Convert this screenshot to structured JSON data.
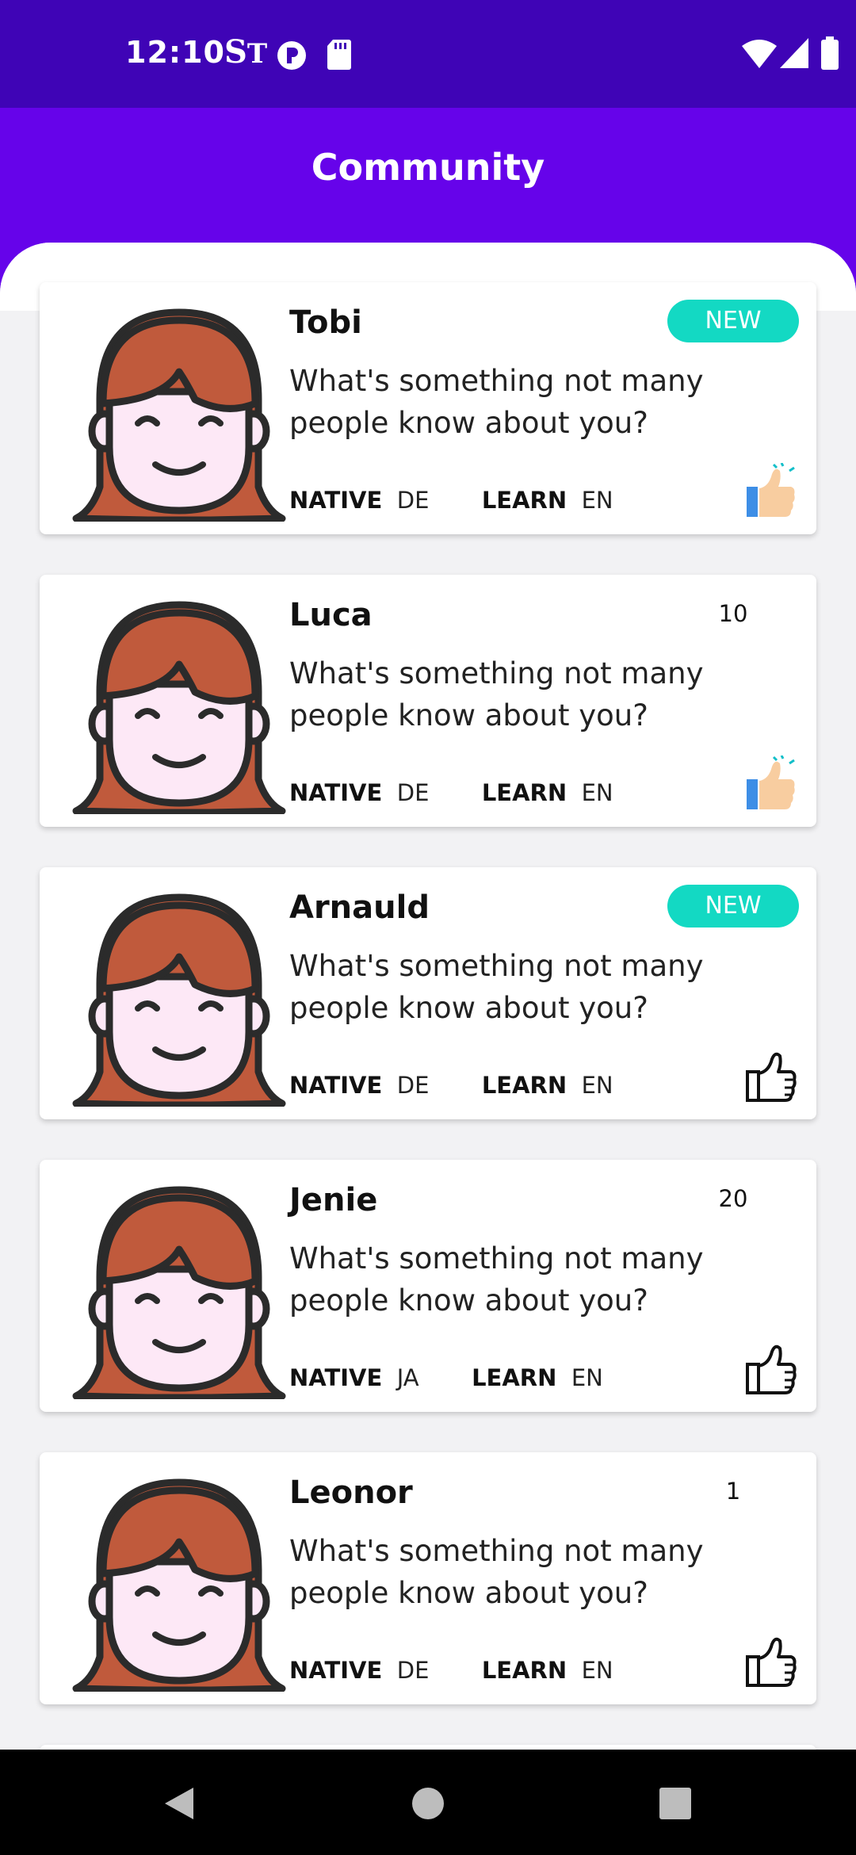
{
  "status_bar": {
    "time": "12:10",
    "left_icons": [
      "st-app-icon",
      "p-app-icon",
      "sd-card-icon"
    ],
    "right_icons": [
      "wifi-icon",
      "cell-signal-icon",
      "battery-icon"
    ]
  },
  "app_bar": {
    "title": "Community"
  },
  "colors": {
    "status_bar": "#3f04b6",
    "app_bar": "#6603ea",
    "new_badge": "#13d9c3",
    "hair": "#c05a3c",
    "face": "#fde8f6"
  },
  "cards": [
    {
      "name": "Tobi",
      "question": "What's something not many people know about you?",
      "native_label": "NATIVE",
      "native": "DE",
      "learn_label": "LEARN",
      "learn": "EN",
      "badge": "NEW",
      "count": "",
      "liked": true
    },
    {
      "name": "Luca",
      "question": "What's something not many people know about you?",
      "native_label": "NATIVE",
      "native": "DE",
      "learn_label": "LEARN",
      "learn": "EN",
      "badge": "",
      "count": "10",
      "liked": true
    },
    {
      "name": "Arnauld",
      "question": "What's something not many people know about you?",
      "native_label": "NATIVE",
      "native": "DE",
      "learn_label": "LEARN",
      "learn": "EN",
      "badge": "NEW",
      "count": "",
      "liked": false
    },
    {
      "name": "Jenie",
      "question": "What's something not many people know about you?",
      "native_label": "NATIVE",
      "native": "JA",
      "learn_label": "LEARN",
      "learn": "EN",
      "badge": "",
      "count": "20",
      "liked": false
    },
    {
      "name": "Leonor",
      "question": "What's something not many people know about you?",
      "native_label": "NATIVE",
      "native": "DE",
      "learn_label": "LEARN",
      "learn": "EN",
      "badge": "",
      "count": "1",
      "liked": false
    }
  ],
  "nav_bar": {
    "icons": [
      "back-icon",
      "home-icon",
      "recents-icon"
    ]
  }
}
